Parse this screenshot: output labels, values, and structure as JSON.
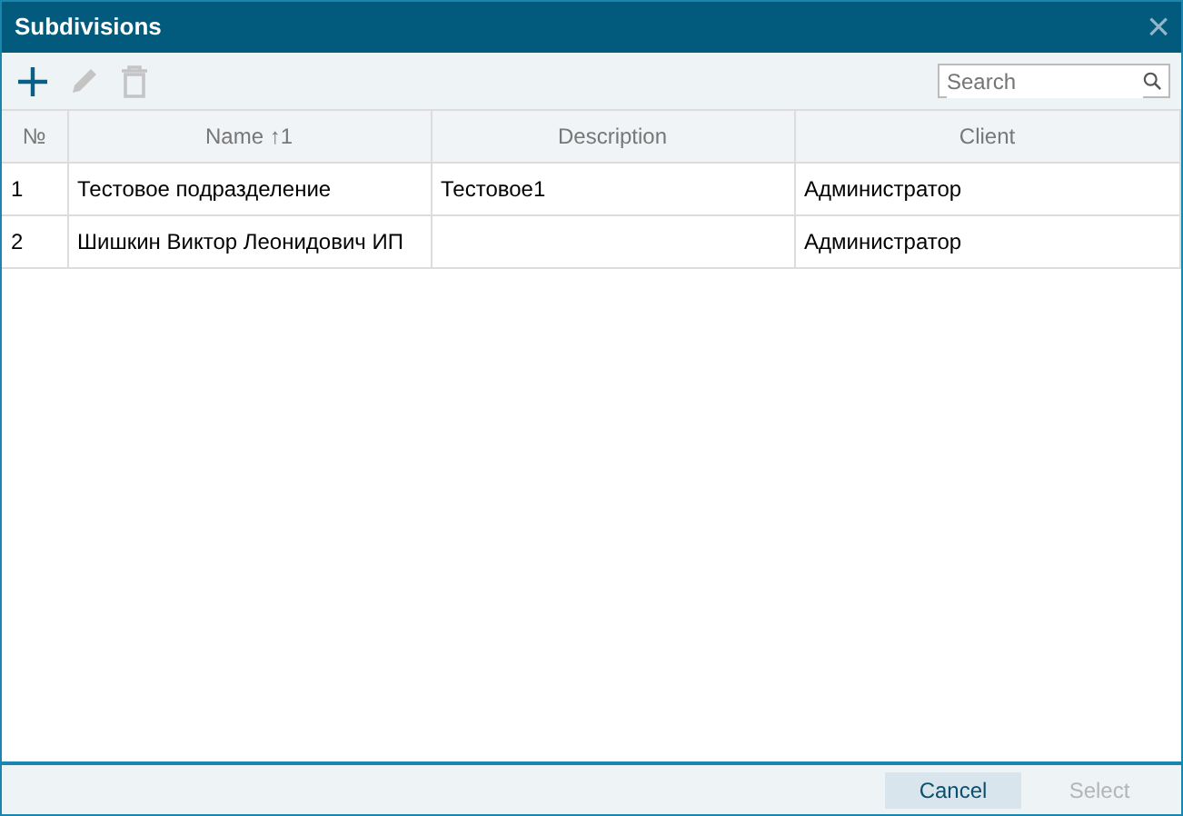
{
  "window": {
    "title": "Subdivisions",
    "close": "×"
  },
  "toolbar": [
    {
      "kind": "add",
      "disabled": false
    },
    {
      "kind": "edit",
      "disabled": true
    },
    {
      "kind": "delete",
      "disabled": true
    }
  ],
  "search": {
    "placeholder": "Search"
  },
  "table": {
    "columns": [
      {
        "label": "№"
      },
      {
        "label": "Name",
        "sort": "↑1"
      },
      {
        "label": "Description"
      },
      {
        "label": "Client"
      }
    ],
    "rows": [
      [
        "1",
        "Тестовое подразделение",
        "Тестовое1",
        "Администратор"
      ],
      [
        "2",
        "Шишкин Виктор Леонидович ИП",
        "",
        "Администратор"
      ]
    ]
  },
  "buttons": [
    {
      "label": "Cancel",
      "disabled": false
    },
    {
      "label": "Select",
      "disabled": true
    }
  ]
}
